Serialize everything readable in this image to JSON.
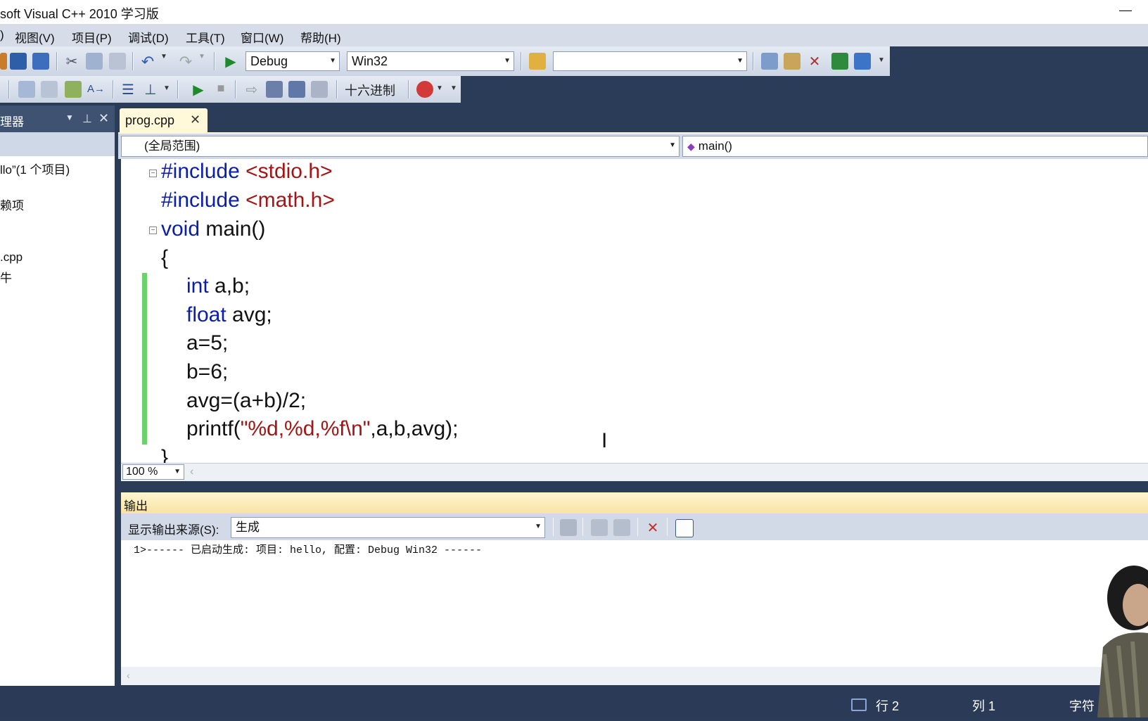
{
  "window": {
    "title": "soft Visual C++ 2010 学习版",
    "minimize": "—"
  },
  "menu": {
    "partial": ")",
    "items": [
      "视图(V)",
      "项目(P)",
      "调试(D)",
      "工具(T)",
      "窗口(W)",
      "帮助(H)"
    ]
  },
  "toolbar": {
    "config": "Debug",
    "platform": "Win32",
    "find_value": "",
    "hex_label": "十六进制"
  },
  "solution_explorer": {
    "title": "理器",
    "items": [
      "llo”(1 个项目)",
      "赖项",
      ".cpp",
      "牛"
    ]
  },
  "tab": {
    "label": "prog.cpp",
    "close": "✕"
  },
  "nav": {
    "scope": "(全局范围)",
    "member": "main()"
  },
  "editor": {
    "lines": [
      {
        "kw": "#include ",
        "str": "<stdio.h>",
        "rest": ""
      },
      {
        "kw": "#include ",
        "str": "<math.h>",
        "rest": ""
      },
      {
        "kw": "void",
        "str": "",
        "rest": " main()"
      },
      {
        "kw": "",
        "str": "",
        "rest": "{"
      },
      {
        "kw": "int",
        "str": "",
        "rest": " a,b;"
      },
      {
        "kw": "float",
        "str": "",
        "rest": " avg;"
      },
      {
        "kw": "",
        "str": "",
        "rest": "a=5;"
      },
      {
        "kw": "",
        "str": "",
        "rest": "b=6;"
      },
      {
        "kw": "",
        "str": "",
        "rest": "avg=(a+b)/2;"
      },
      {
        "kw": "",
        "str": "",
        "rest": "printf("
      },
      {
        "kw": "",
        "str": "",
        "rest": "}"
      }
    ],
    "printf_str": "\"%d,%d,%f\\n\"",
    "printf_rest": ",a,b,avg);",
    "zoom": "100 %"
  },
  "output": {
    "title": "输出",
    "source_label": "显示输出来源(S):",
    "source_value": "生成",
    "line": "1>------ 已启动生成: 项目: hello, 配置: Debug Win32 ------"
  },
  "status": {
    "row": "行 2",
    "col": "列 1",
    "char": "字符"
  },
  "colors": {
    "keyword": "#0a1ea8",
    "string": "#a31515",
    "change_bar": "#6cd26c",
    "tab_active": "#fff8d9"
  }
}
